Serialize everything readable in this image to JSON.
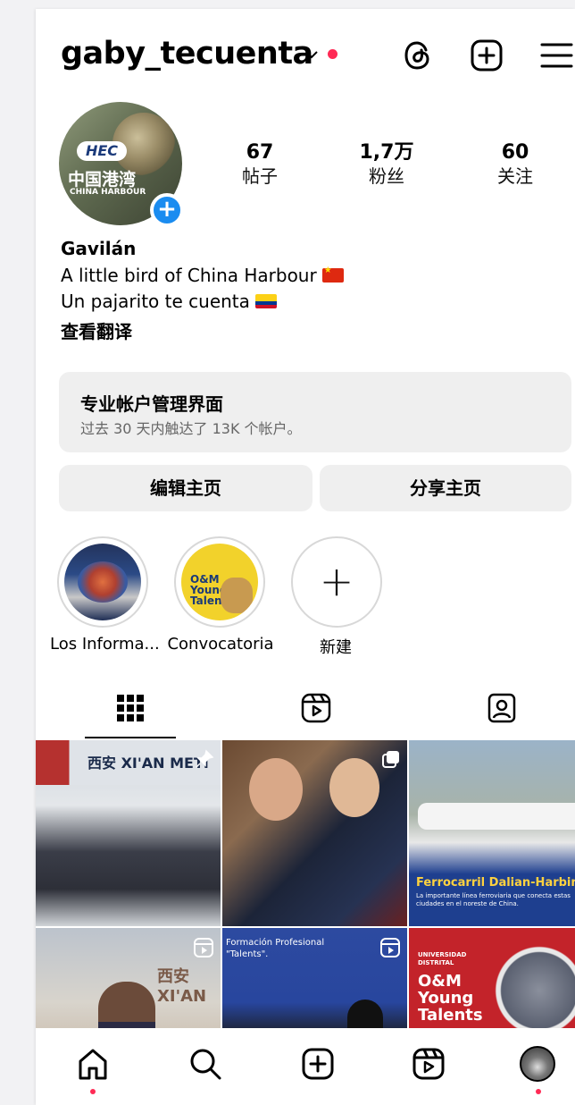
{
  "header": {
    "username": "gaby_tecuenta"
  },
  "avatar": {
    "logo_top": "HEC",
    "logo_cn": "中国港湾",
    "logo_en": "CHINA HARBOUR",
    "plus": "+"
  },
  "stats": [
    {
      "value": "67",
      "label": "帖子"
    },
    {
      "value": "1,7万",
      "label": "粉丝"
    },
    {
      "value": "60",
      "label": "关注"
    }
  ],
  "bio": {
    "name": "Gavilán",
    "line1": "A little bird of China Harbour",
    "line2": "Un pajarito te cuenta",
    "translate": "查看翻译"
  },
  "dashboard": {
    "title": "专业帐户管理界面",
    "subtitle": "过去 30 天内触达了 13K 个帐户。"
  },
  "buttons": {
    "edit": "编辑主页",
    "share": "分享主页"
  },
  "highlights": [
    {
      "label": "Los Informa..."
    },
    {
      "label": "Convocatoria",
      "cover_text": "O&M Young Talents"
    },
    {
      "label": "新建",
      "icon": "+"
    }
  ],
  "grid": {
    "tile1_sign": "西安 XI'AN METI",
    "tile3_title": "Ferrocarril Dalian-Harbin",
    "tile3_sub": "La importante línea ferroviaria que conecta estas ciudades en el noreste de China.",
    "tile4_sign": "西安 XI'AN",
    "tile5_text": "Formación Profesional \"Talents\".",
    "tile6_top": "UNIVERSIDAD DISTRITAL",
    "tile6_title": "O&M Young Talents"
  },
  "colors": {
    "accent_blue": "#1a8cf0",
    "notification_red": "#ff2a55",
    "surface_gray": "#efefef"
  }
}
